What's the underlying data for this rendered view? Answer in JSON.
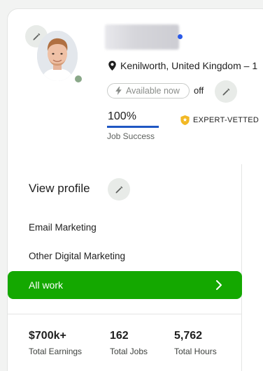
{
  "profile": {
    "location": "Kenilworth, United Kingdom – 1",
    "availability": {
      "label": "Available now",
      "state_label": "off"
    },
    "job_success": {
      "value": "100%",
      "label": "Job Success",
      "fraction": 1.0
    },
    "badge": "EXPERT-VETTED"
  },
  "nav": {
    "view_profile": "View profile",
    "skills": [
      "Email Marketing",
      "Other Digital Marketing"
    ],
    "all_work": "All work"
  },
  "stats": [
    {
      "value": "$700k+",
      "label": "Total Earnings"
    },
    {
      "value": "162",
      "label": "Total Jobs"
    },
    {
      "value": "5,762",
      "label": "Total Hours"
    }
  ],
  "colors": {
    "accent_green": "#14a800",
    "jss_blue": "#1f57c3",
    "online_dot": "#8aa889",
    "badge_gold": "#f2b824"
  },
  "icons": [
    "pencil-icon",
    "location-pin-icon",
    "lightning-icon",
    "shield-badge-icon",
    "chevron-right-icon"
  ]
}
